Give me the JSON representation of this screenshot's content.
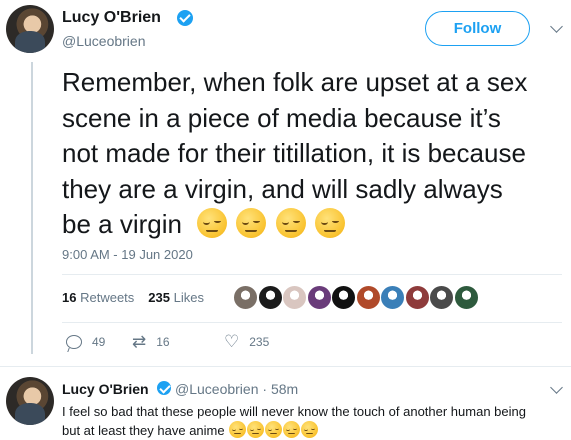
{
  "tweet": {
    "author_name": "Lucy O'Brien",
    "author_handle": "@Luceobrien",
    "follow_label": "Follow",
    "text_lines": [
      "Remember, when folk are upset at a sex",
      "scene in a piece of media because it’s",
      "not made for their titillation, it is because",
      "they are a virgin, and will sadly always",
      "be a virgin"
    ],
    "emoji": "pensive-face-emoji",
    "emoji_count": 4,
    "timestamp": "9:00 AM - 19 Jun 2020",
    "retweets_count": "16",
    "retweets_label": "Retweets",
    "likes_count": "235",
    "likes_label": "Likes",
    "liker_avatar_colors": [
      "#7a6f66",
      "#1b1b1b",
      "#d9c6c0",
      "#6a3c7a",
      "#111111",
      "#b04a2a",
      "#3a7fb8",
      "#8e3b3b",
      "#4a4a4a",
      "#2e5a3d"
    ],
    "reply_count": "49",
    "retweet_count": "16",
    "like_count": "235"
  },
  "reply": {
    "author_name": "Lucy O'Brien",
    "author_handle": "@Luceobrien",
    "time_ago": "58m",
    "separator": "·",
    "text_line1": "I feel so bad that these people will never know the touch of another human being",
    "text_line2": "but at least they have anime",
    "emoji_count": 5
  },
  "colors": {
    "accent": "#1da1f2",
    "text": "#14171a",
    "muted": "#657786",
    "divider": "#e6ecf0"
  }
}
